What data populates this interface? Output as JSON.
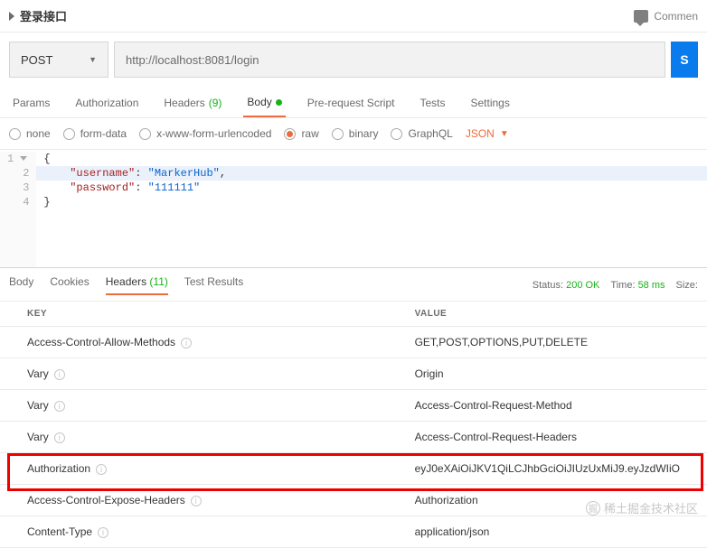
{
  "header": {
    "title": "登录接口",
    "comments_label": "Commen"
  },
  "request": {
    "method": "POST",
    "url": "http://localhost:8081/login",
    "send_label": "S"
  },
  "tabs": {
    "params": "Params",
    "authorization": "Authorization",
    "headers": "Headers",
    "headers_count": "(9)",
    "body": "Body",
    "prerequest": "Pre-request Script",
    "tests": "Tests",
    "settings": "Settings"
  },
  "body_types": {
    "none": "none",
    "form_data": "form-data",
    "urlencoded": "x-www-form-urlencoded",
    "raw": "raw",
    "binary": "binary",
    "graphql": "GraphQL",
    "subtype": "JSON"
  },
  "code": {
    "line1_open": "{",
    "line2_key": "\"username\"",
    "line2_val": "\"MarkerHub\"",
    "line3_key": "\"password\"",
    "line3_val": "\"111111\"",
    "line4_close": "}"
  },
  "resp_tabs": {
    "body": "Body",
    "cookies": "Cookies",
    "headers": "Headers",
    "headers_count": "(11)",
    "test_results": "Test Results"
  },
  "status": {
    "status_label": "Status:",
    "status_value": "200 OK",
    "time_label": "Time:",
    "time_value": "58 ms",
    "size_label": "Size:"
  },
  "table": {
    "key_header": "KEY",
    "value_header": "VALUE",
    "rows": [
      {
        "key": "Access-Control-Allow-Methods",
        "value": "GET,POST,OPTIONS,PUT,DELETE"
      },
      {
        "key": "Vary",
        "value": "Origin"
      },
      {
        "key": "Vary",
        "value": "Access-Control-Request-Method"
      },
      {
        "key": "Vary",
        "value": "Access-Control-Request-Headers"
      },
      {
        "key": "Authorization",
        "value": "eyJ0eXAiOiJKV1QiLCJhbGciOiJIUzUxMiJ9.eyJzdWIiO"
      },
      {
        "key": "Access-Control-Expose-Headers",
        "value": "Authorization"
      },
      {
        "key": "Content-Type",
        "value": "application/json"
      }
    ]
  },
  "watermark": "稀土掘金技术社区"
}
